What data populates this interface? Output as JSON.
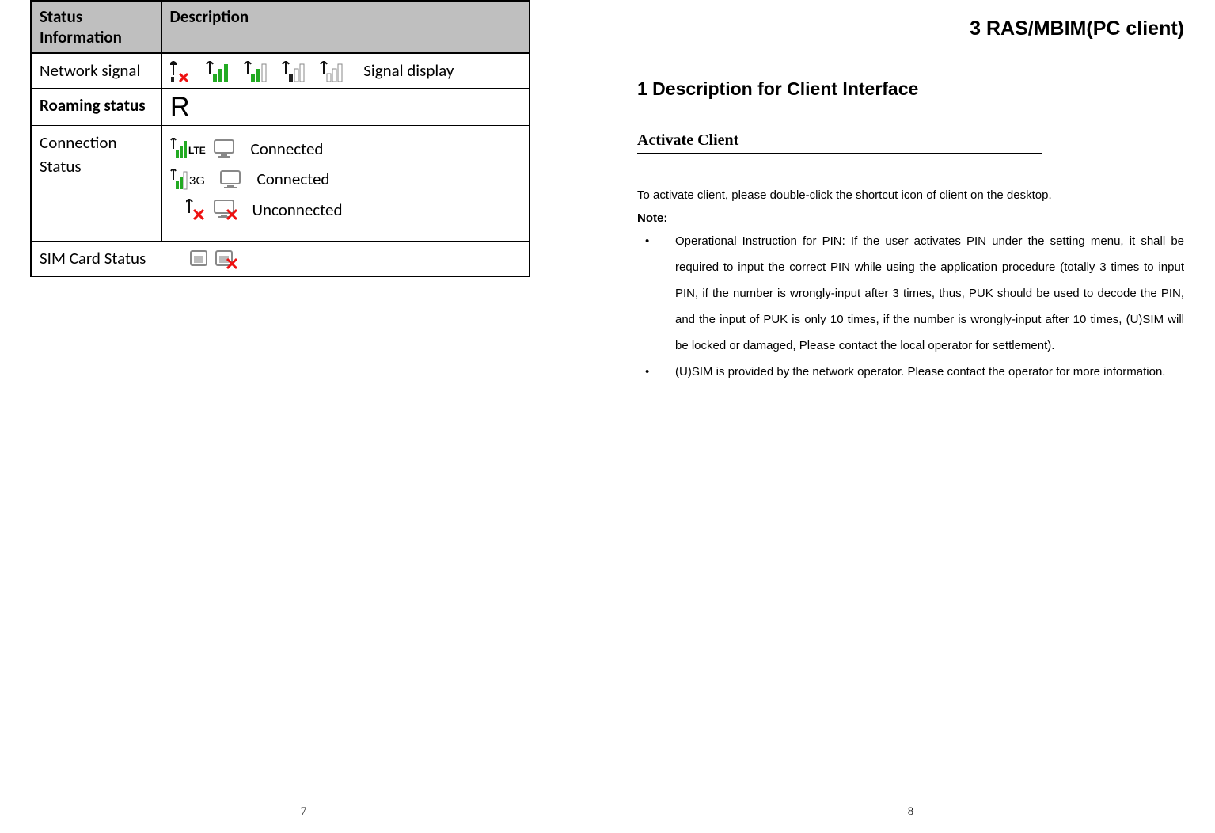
{
  "left_page": {
    "table": {
      "headers": [
        "Status Information",
        "Description"
      ],
      "rows": [
        {
          "label": "Network signal",
          "bold": false,
          "desc_text": "Signal display"
        },
        {
          "label": "Roaming status",
          "bold": true,
          "desc_text": ""
        },
        {
          "label": "Connection Status",
          "bold": false,
          "lines": [
            {
              "text": "Connected"
            },
            {
              "text": "Connected"
            },
            {
              "text": "Unconnected"
            }
          ]
        },
        {
          "label": "SIM Card Status",
          "bold": false,
          "desc_text": ""
        }
      ]
    },
    "page_number": "7"
  },
  "right_page": {
    "chapter_title": "3  RAS/MBIM(PC  client)",
    "section_heading": "1 Description for Client Interface",
    "subsection_heading": "Activate Client",
    "body_text": "To activate client, please double-click the shortcut icon of client on the desktop.",
    "note_label": "Note:",
    "bullets": [
      "Operational Instruction for PIN: If the user activates PIN under the setting menu, it shall be required to input the correct PIN while using the application procedure (totally 3 times to input PIN, if the number is wrongly-input after 3 times, thus, PUK should be used to decode the PIN, and the input of PUK is only 10 times, if the number is wrongly-input after 10 times, (U)SIM will be locked or damaged,    Please contact the local operator for settlement).",
      "(U)SIM is provided by the network operator. Please contact the operator for more information."
    ],
    "page_number": "8"
  },
  "icons": {
    "signal_no": "signal-no-icon",
    "signal_full_green": "signal-full-green-icon",
    "signal_med_green": "signal-med-green-icon",
    "signal_low": "signal-low-icon",
    "signal_min": "signal-min-icon",
    "roaming_r": "roaming-r-icon",
    "signal_lte": "signal-lte-icon",
    "signal_3g": "signal-3g-icon",
    "signal_x": "signal-x-icon",
    "computer_ok": "computer-ok-icon",
    "computer_x": "computer-x-icon",
    "sim_ok": "sim-ok-icon",
    "sim_x": "sim-x-icon"
  }
}
